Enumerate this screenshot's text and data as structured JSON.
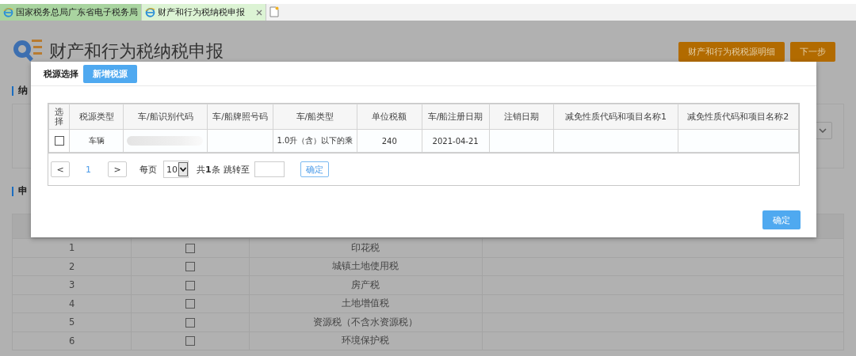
{
  "browser_tabs": [
    {
      "label": "国家税务总局广东省电子税务局",
      "selected": false
    },
    {
      "label": "财产和行为税纳税申报",
      "selected": true
    }
  ],
  "page": {
    "title": "财产和行为税纳税申报",
    "buttons": [
      "财产和行为税税源明细",
      "下一步"
    ],
    "sections": [
      "纳",
      "申"
    ]
  },
  "background_table": {
    "rows": [
      {
        "number": "1",
        "checked": false,
        "name": "印花税"
      },
      {
        "number": "2",
        "checked": false,
        "name": "城镇土地使用税"
      },
      {
        "number": "3",
        "checked": false,
        "name": "房产税"
      },
      {
        "number": "4",
        "checked": false,
        "name": "土地增值税"
      },
      {
        "number": "5",
        "checked": false,
        "name": "资源税（不含水资源税）"
      },
      {
        "number": "6",
        "checked": false,
        "name": "环境保护税"
      }
    ]
  },
  "modal": {
    "title": "税源选择",
    "add_button": "新增税源",
    "table": {
      "columns": [
        "选择",
        "税源类型",
        "车/船识别代码",
        "车/船牌照号码",
        "车/船类型",
        "单位税额",
        "车/船注册日期",
        "注销日期",
        "减免性质代码和项目名称1",
        "减免性质代码和项目名称2"
      ],
      "rows": [
        {
          "cells": [
            {
              "kind": "checkbox",
              "checked": false
            },
            {
              "kind": "text",
              "text": "车辆"
            },
            {
              "kind": "redacted"
            },
            {
              "kind": "empty"
            },
            {
              "kind": "text",
              "text": "1.0升（含）以下的乘"
            },
            {
              "kind": "text",
              "text": "240"
            },
            {
              "kind": "text",
              "text": "2021-04-21"
            },
            {
              "kind": "empty"
            },
            {
              "kind": "empty"
            },
            {
              "kind": "empty"
            }
          ]
        }
      ]
    },
    "pagination": {
      "prev": "<",
      "page": "1",
      "next": ">",
      "per_page_label": "每页",
      "per_page_value": "10",
      "total": "共**1**条",
      "jump_label": "跳转至",
      "go_button": "确定"
    },
    "confirm_button": "确定"
  }
}
